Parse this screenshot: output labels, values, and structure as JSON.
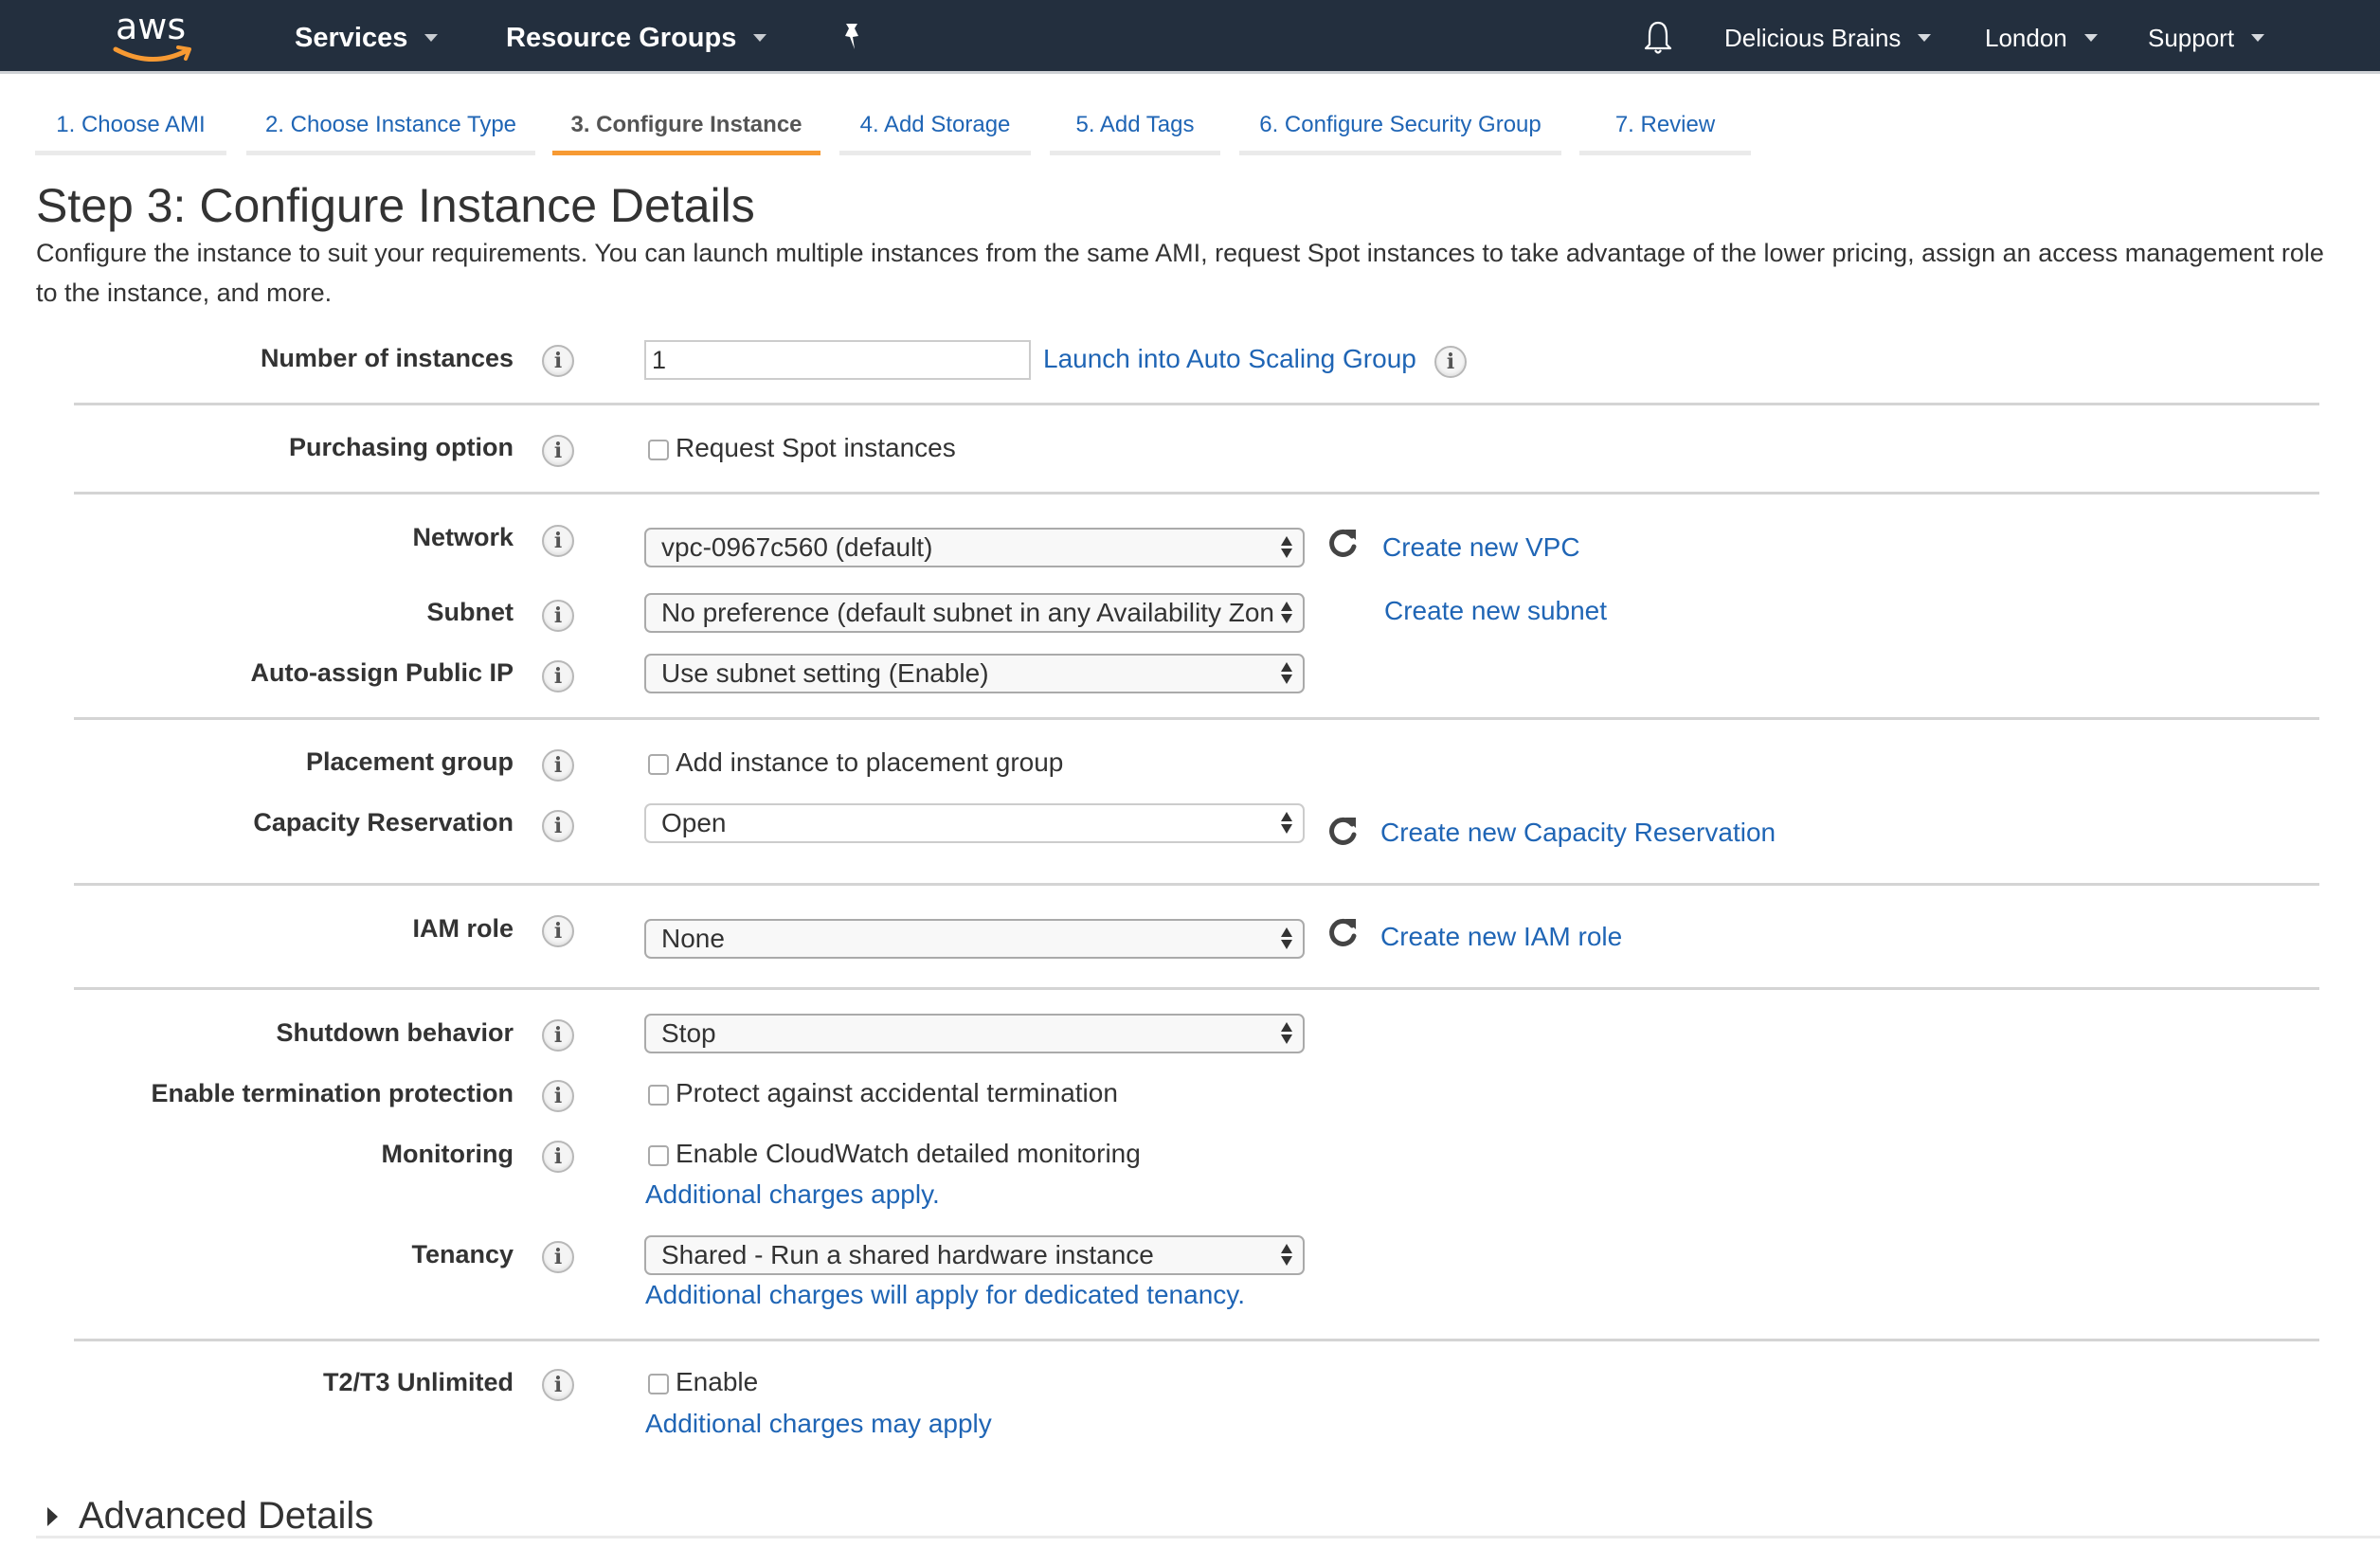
{
  "header": {
    "logo": "aws",
    "nav_left": [
      {
        "label": "Services",
        "icon": "chevron-down-icon"
      },
      {
        "label": "Resource Groups",
        "icon": "chevron-down-icon"
      }
    ],
    "pin_icon": "pushpin-icon",
    "bell_icon": "bell-icon",
    "nav_right": [
      {
        "label": "Delicious Brains",
        "icon": "chevron-down-icon"
      },
      {
        "label": "London",
        "icon": "chevron-down-icon"
      },
      {
        "label": "Support",
        "icon": "chevron-down-icon"
      }
    ]
  },
  "wizard": {
    "tabs": [
      {
        "label": "1. Choose AMI",
        "active": false
      },
      {
        "label": "2. Choose Instance Type",
        "active": false
      },
      {
        "label": "3. Configure Instance",
        "active": true
      },
      {
        "label": "4. Add Storage",
        "active": false
      },
      {
        "label": "5. Add Tags",
        "active": false
      },
      {
        "label": "6. Configure Security Group",
        "active": false
      },
      {
        "label": "7. Review",
        "active": false
      }
    ]
  },
  "page": {
    "title": "Step 3: Configure Instance Details",
    "description": "Configure the instance to suit your requirements. You can launch multiple instances from the same AMI, request Spot instances to take advantage of the lower pricing, assign an access management role to the instance, and more."
  },
  "form": {
    "number_of_instances": {
      "label": "Number of instances",
      "value": "1",
      "link": "Launch into Auto Scaling Group"
    },
    "purchasing_option": {
      "label": "Purchasing option",
      "checkbox_label": "Request Spot instances",
      "checked": false
    },
    "network": {
      "label": "Network",
      "value": "vpc-0967c560 (default)",
      "link": "Create new VPC"
    },
    "subnet": {
      "label": "Subnet",
      "value": "No preference (default subnet in any Availability Zon",
      "link": "Create new subnet"
    },
    "auto_assign_ip": {
      "label": "Auto-assign Public IP",
      "value": "Use subnet setting (Enable)"
    },
    "placement_group": {
      "label": "Placement group",
      "checkbox_label": "Add instance to placement group",
      "checked": false
    },
    "capacity_reservation": {
      "label": "Capacity Reservation",
      "value": "Open",
      "link": "Create new Capacity Reservation"
    },
    "iam_role": {
      "label": "IAM role",
      "value": "None",
      "link": "Create new IAM role"
    },
    "shutdown_behavior": {
      "label": "Shutdown behavior",
      "value": "Stop"
    },
    "termination_protection": {
      "label": "Enable termination protection",
      "checkbox_label": "Protect against accidental termination",
      "checked": false
    },
    "monitoring": {
      "label": "Monitoring",
      "checkbox_label": "Enable CloudWatch detailed monitoring",
      "checked": false,
      "link": "Additional charges apply."
    },
    "tenancy": {
      "label": "Tenancy",
      "value": "Shared - Run a shared hardware instance",
      "link": "Additional charges will apply for dedicated tenancy."
    },
    "t2t3_unlimited": {
      "label": "T2/T3 Unlimited",
      "checkbox_label": "Enable",
      "checked": false,
      "link": "Additional charges may apply"
    }
  },
  "advanced": {
    "label": "Advanced Details",
    "icon": "caret-right-icon"
  },
  "colors": {
    "header_bg": "#232f3e",
    "link": "#1f65b5",
    "active_tab_underline": "#f79a33",
    "logo_smile": "#f79a33"
  }
}
